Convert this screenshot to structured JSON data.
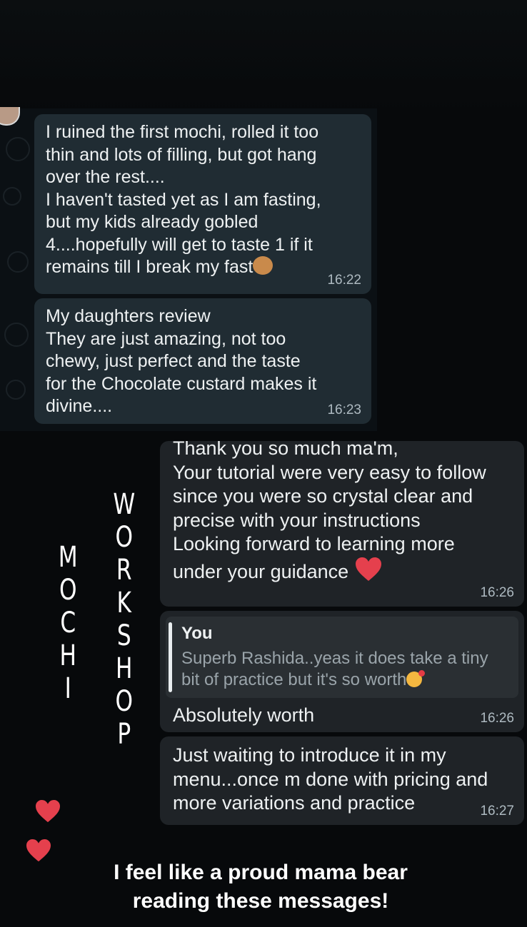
{
  "received_messages": [
    {
      "text": "I ruined the first mochi, rolled it too\nthin and lots of filling, but got hang\nover the rest....\nI haven't tasted yet as I am fasting,\nbut my kids already gobled\n4....hopefully will get to taste 1 if it\nremains till I break my fast",
      "emoji": "see-no-evil-monkey",
      "time": "16:22"
    },
    {
      "text": "My daughters review\nThey are just amazing,  not too\nchewy, just perfect and the taste\nfor the Chocolate custard makes it\ndivine....",
      "time": "16:23"
    }
  ],
  "sent_messages": [
    {
      "text": "Thank you so much ma'm,\nYour tutorial were very easy to follow\nsince you were so crystal clear and\nprecise with your instructions\nLooking forward to learning more\nunder your guidance",
      "emoji": "red-heart",
      "time": "16:26"
    },
    {
      "quote_author": "You",
      "quote_text": "Superb Rashida..yeas it does take a tiny\nbit of practice but it's so worth",
      "quote_emoji": "face-blowing-kiss",
      "text": "Absolutely worth",
      "time": "16:26"
    },
    {
      "text": "Just waiting to introduce it in my\nmenu...once m done with pricing and\nmore variations and practice",
      "time": "16:27"
    }
  ],
  "overlay": {
    "word_mochi": [
      "M",
      "O",
      "C",
      "H",
      "I"
    ],
    "word_workshop": [
      "W",
      "O",
      "R",
      "K",
      "S",
      "H",
      "O",
      "P"
    ],
    "hearts": [
      "red-heart",
      "red-heart"
    ],
    "caption": "I feel like a proud mama bear\nreading these messages!"
  },
  "colors": {
    "background": "#07090b",
    "bubble_received": "#202c33",
    "bubble_sent": "#1f2327",
    "heart": "#e5404d",
    "emoji_yellow": "#f4b740"
  }
}
